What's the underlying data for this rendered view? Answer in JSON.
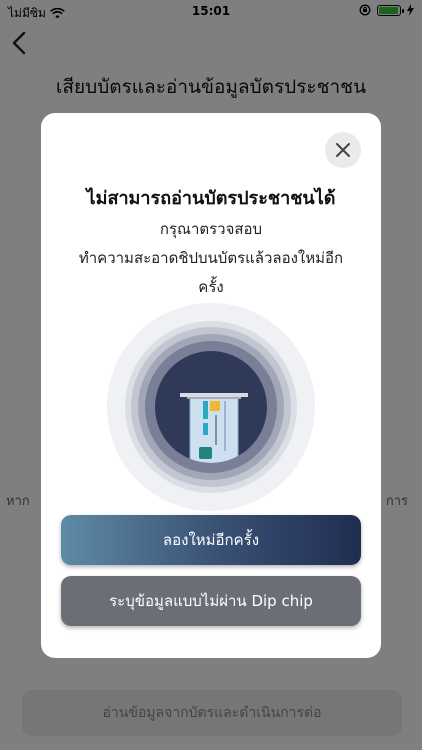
{
  "status": {
    "carrier": "ไม่มีซิม",
    "time": "15:01",
    "battery_color": "#2ecc40"
  },
  "page": {
    "title": "เสียบบัตรและอ่านข้อมูลบัตรประชาชน",
    "bg_left": "หาก",
    "bg_right": "การ",
    "continue_label": "อ่านข้อมูลจากบัตรและดำเนินการต่อ"
  },
  "modal": {
    "title": "ไม่สามารถอ่านบัตรประชาชนได้",
    "line1": "กรุณาตรวจสอบ",
    "line2": "ทำความสะอาดชิปบนบัตรแล้วลองใหม่อีก",
    "line3": "ครั้ง",
    "retry_label": "ลองใหม่อีกครั้ง",
    "manual_label": "ระบุข้อมูลแบบไม่ผ่าน Dip chip",
    "close_icon": "close-icon"
  }
}
